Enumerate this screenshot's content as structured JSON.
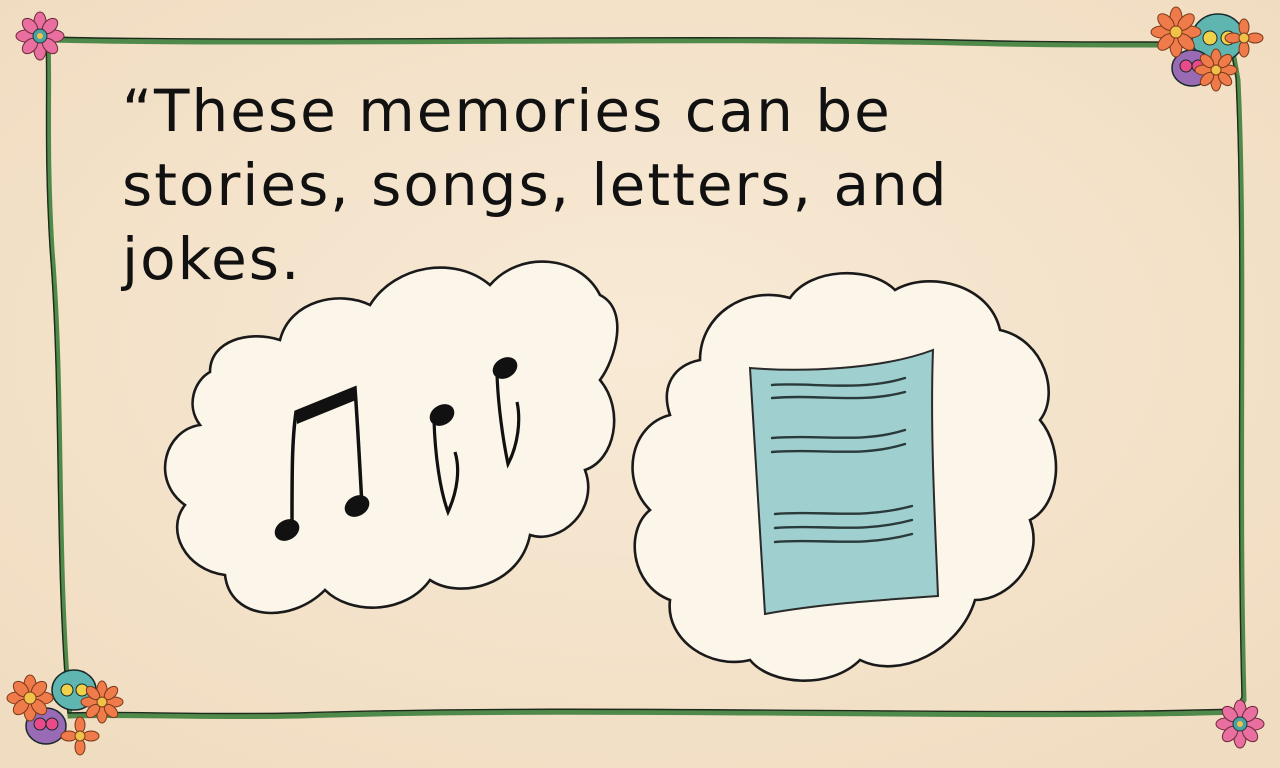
{
  "caption": {
    "line1": "“These memories can be",
    "line2": "stories, songs, letters, and",
    "line3": "jokes."
  },
  "colors": {
    "paper": "#f6e6cf",
    "frame": "#4f8a4a",
    "cloud": "#fbf5ea",
    "letter": "#9fcfcf",
    "ink": "#111111",
    "flower_orange": "#ef7b4a",
    "flower_pink": "#e96fa0",
    "skull_teal": "#5fb5b0",
    "skull_purple": "#9a6bb5"
  },
  "icons": [
    "music-notes-icon",
    "letter-paper-icon",
    "marigold-flower-icon",
    "sugar-skull-icon"
  ]
}
